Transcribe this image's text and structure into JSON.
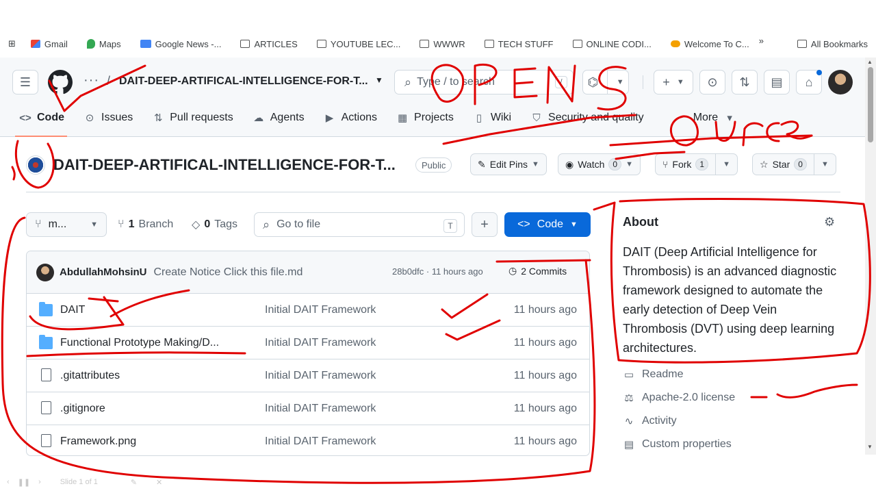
{
  "bookmarks": {
    "apps_glyph": "⊞",
    "items": [
      {
        "label": "Gmail",
        "icon": "gmail-icon"
      },
      {
        "label": "Maps",
        "icon": "maps-icon"
      },
      {
        "label": "Google News -...",
        "icon": "news-icon"
      },
      {
        "label": "ARTICLES",
        "icon": "folder-icon"
      },
      {
        "label": "YOUTUBE LEC...",
        "icon": "folder-icon"
      },
      {
        "label": "WWWR",
        "icon": "folder-icon"
      },
      {
        "label": "TECH STUFF",
        "icon": "folder-icon"
      },
      {
        "label": "ONLINE CODI...",
        "icon": "folder-icon"
      },
      {
        "label": "Welcome To C...",
        "icon": "site-icon"
      }
    ],
    "more_glyph": "»",
    "all_label": "All Bookmarks"
  },
  "header": {
    "menu_glyph": "☰",
    "dots": "···",
    "slash": "/",
    "repo_crumb": "DAIT-DEEP-ARTIFICAL-INTELLIGENCE-FOR-T...",
    "caret": "▼",
    "search_placeholder": "Type / to search",
    "search_icon": "⌕",
    "search_kbd": "/",
    "copilot_icon": "⌬",
    "plus": "+",
    "issues_icon": "⊙",
    "pr_icon": "⇅",
    "repo_icon": "▤",
    "inbox_icon": "⌂"
  },
  "tabs": [
    {
      "label": "Code",
      "icon": "<>"
    },
    {
      "label": "Issues",
      "icon": "⊙"
    },
    {
      "label": "Pull requests",
      "icon": "⇅"
    },
    {
      "label": "Agents",
      "icon": "☁"
    },
    {
      "label": "Actions",
      "icon": "▶"
    },
    {
      "label": "Projects",
      "icon": "▦"
    },
    {
      "label": "Wiki",
      "icon": "▯"
    },
    {
      "label": "Security and quality",
      "icon": "⛉"
    },
    {
      "label": "More",
      "icon": "▾"
    }
  ],
  "repo": {
    "name": "DAIT-DEEP-ARTIFICAL-INTELLIGENCE-FOR-T...",
    "visibility": "Public",
    "edit_pins": "Edit Pins",
    "watch": "Watch",
    "watch_count": "0",
    "fork": "Fork",
    "fork_count": "1",
    "star": "Star",
    "star_count": "0"
  },
  "controls": {
    "branch_label": "m...",
    "branch_count": "1",
    "branch_word": "Branch",
    "tag_count": "0",
    "tag_word": "Tags",
    "goto_placeholder": "Go to file",
    "goto_kbd": "T",
    "plus": "+",
    "code_label": "Code"
  },
  "latest_commit": {
    "author": "AbdullahMohsinU",
    "message": "Create Notice Click this file.md",
    "sha_time": "28b0dfc · 11 hours ago",
    "commits": "2 Commits"
  },
  "files": [
    {
      "name": "DAIT",
      "type": "folder",
      "message": "Initial DAIT Framework",
      "time": "11 hours ago"
    },
    {
      "name": "Functional Prototype Making/D...",
      "type": "folder",
      "message": "Initial DAIT Framework",
      "time": "11 hours ago"
    },
    {
      "name": ".gitattributes",
      "type": "file",
      "message": "Initial DAIT Framework",
      "time": "11 hours ago"
    },
    {
      "name": ".gitignore",
      "type": "file",
      "message": "Initial DAIT Framework",
      "time": "11 hours ago"
    },
    {
      "name": "Framework.png",
      "type": "file",
      "message": "Initial DAIT Framework",
      "time": "11 hours ago"
    }
  ],
  "about": {
    "heading": "About",
    "description": "DAIT (Deep Artificial Intelligence for Thrombosis) is an advanced diagnostic framework designed to automate the early detection of Deep Vein Thrombosis (DVT) using deep learning architectures.",
    "links": [
      {
        "label": "Readme",
        "icon": "book-icon",
        "glyph": "▭"
      },
      {
        "label": "Apache-2.0 license",
        "icon": "scale-icon",
        "glyph": "⚖"
      },
      {
        "label": "Activity",
        "icon": "pulse-icon",
        "glyph": "∿"
      },
      {
        "label": "Custom properties",
        "icon": "note-icon",
        "glyph": "▤"
      }
    ]
  },
  "slide": {
    "label": "Slide 1 of 1"
  },
  "colors": {
    "accent": "#0969da",
    "annotation": "#e00000",
    "active_tab": "#fd8c73"
  }
}
